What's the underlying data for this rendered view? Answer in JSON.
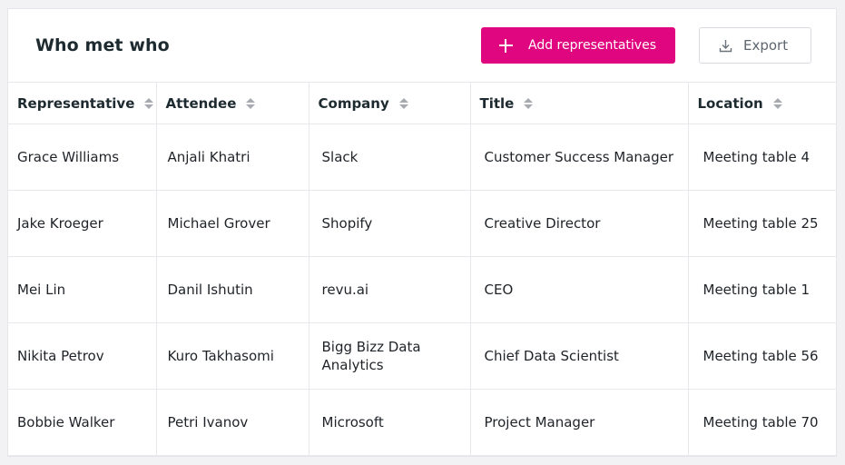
{
  "header": {
    "title": "Who met who",
    "add_button_label": "Add representatives",
    "export_button_label": "Export"
  },
  "colors": {
    "accent": "#e0067f",
    "background": "#f2f2f4",
    "border": "#e8e8ec"
  },
  "icons": {
    "add": "plus-icon",
    "export": "download-icon",
    "sort": "sort-icon"
  },
  "table": {
    "columns": [
      "Representative",
      "Attendee",
      "Company",
      "Title",
      "Location"
    ],
    "rows": [
      [
        "Grace Williams",
        "Anjali Khatri",
        "Slack",
        "Customer Success Manager",
        "Meeting table 4"
      ],
      [
        "Jake Kroeger",
        "Michael Grover",
        "Shopify",
        "Creative Director",
        "Meeting table 25"
      ],
      [
        "Mei Lin",
        "Danil Ishutin",
        "revu.ai",
        "CEO",
        "Meeting table 1"
      ],
      [
        "Nikita Petrov",
        "Kuro Takhasomi",
        "Bigg Bizz Data Analytics",
        "Chief Data Scientist",
        "Meeting table 56"
      ],
      [
        "Bobbie Walker",
        "Petri Ivanov",
        "Microsoft",
        "Project Manager",
        "Meeting table 70"
      ]
    ]
  }
}
